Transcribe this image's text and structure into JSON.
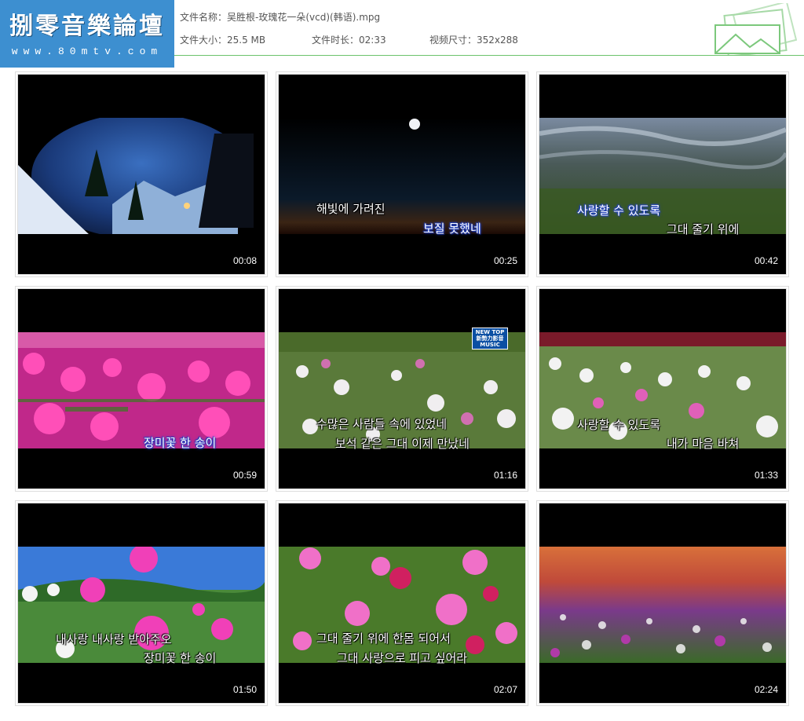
{
  "logo": {
    "title": "捌零音樂論壇",
    "url": "www.80mtv.com"
  },
  "file_info": {
    "name_label": "文件名称：",
    "name_value": "吴胜根-玫瑰花一朵(vcd)(韩语).mpg",
    "size_label": "文件大小：",
    "size_value": "25.5 MB",
    "duration_label": "文件时长：",
    "duration_value": "02:33",
    "dimension_label": "视频尺寸：",
    "dimension_value": "352x288"
  },
  "thumbnails": [
    {
      "timecode": "00:08",
      "lyrics": []
    },
    {
      "timecode": "00:25",
      "lyrics": [
        "해빛에 가려진",
        "보질 못했네"
      ]
    },
    {
      "timecode": "00:42",
      "lyrics": [
        "사랑할 수 있도록",
        "그대 줄기 위에"
      ]
    },
    {
      "timecode": "00:59",
      "lyrics": [
        "장미꽃 한 송이"
      ]
    },
    {
      "timecode": "01:16",
      "lyrics": [
        "수많은 사람들 속에 있었네",
        "보석 같은 그대 이제 만났네"
      ],
      "channel_logo": "NEW TOP 新勢力影音 MUSIC"
    },
    {
      "timecode": "01:33",
      "lyrics": [
        "사랑할 수 있도록",
        "내가 마음 바쳐"
      ]
    },
    {
      "timecode": "01:50",
      "lyrics": [
        "내사랑 내사랑 받아주오",
        "장미꽃 한 송이"
      ]
    },
    {
      "timecode": "02:07",
      "lyrics": [
        "그대 줄기 위에 한몸 되어서",
        "그대 사랑으로 피고 싶어라"
      ]
    },
    {
      "timecode": "02:24",
      "lyrics": []
    }
  ],
  "colors": {
    "logo_bg": "#3d8fd0",
    "header_line": "#6cc36c"
  }
}
